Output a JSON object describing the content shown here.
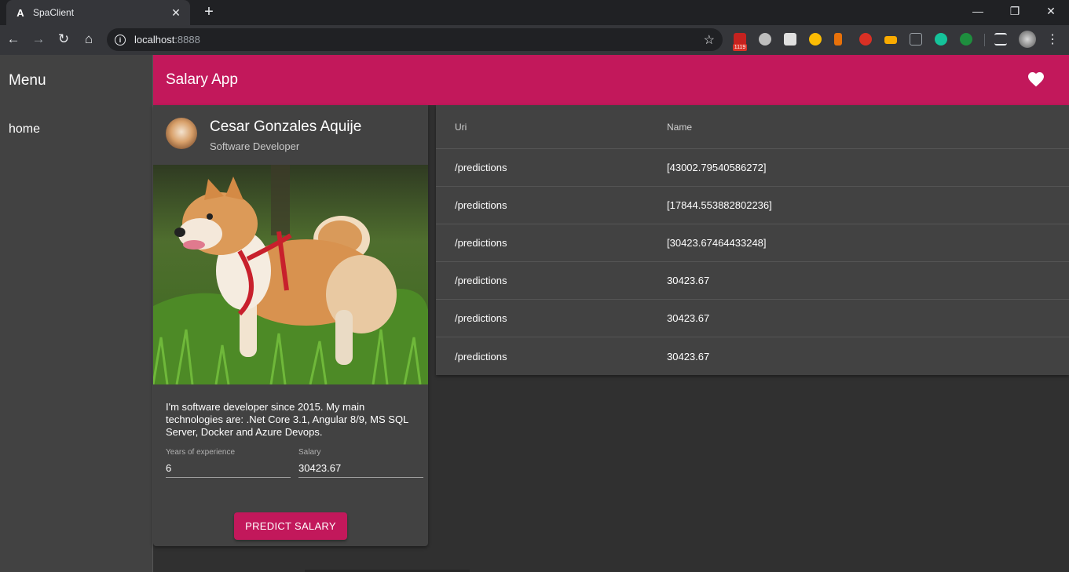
{
  "browser": {
    "tab_title": "SpaClient",
    "favicon_letter": "A",
    "url_host": "localhost",
    "url_port": ":8888",
    "extension_badge": "1119"
  },
  "sidenav": {
    "title": "Menu",
    "items": [
      {
        "label": "home"
      }
    ]
  },
  "toolbar": {
    "title": "Salary App",
    "accent_color": "#c2185b"
  },
  "profile_card": {
    "name": "Cesar Gonzales Aquije",
    "subtitle": "Software Developer",
    "description": "I'm software developer since 2015. My main technologies are: .Net Core 3.1, Angular 8/9, MS SQL Server, Docker and Azure Devops.",
    "fields": [
      {
        "label": "Years of experience",
        "value": "6"
      },
      {
        "label": "Salary",
        "value": "30423.67"
      }
    ],
    "button_label": "PREDICT SALARY"
  },
  "predictions_table": {
    "columns": [
      "Uri",
      "Name"
    ],
    "rows": [
      [
        "/predictions",
        "[43002.79540586272]"
      ],
      [
        "/predictions",
        "[17844.553882802236]"
      ],
      [
        "/predictions",
        "[30423.67464433248]"
      ],
      [
        "/predictions",
        "30423.67"
      ],
      [
        "/predictions",
        "30423.67"
      ],
      [
        "/predictions",
        "30423.67"
      ]
    ]
  }
}
